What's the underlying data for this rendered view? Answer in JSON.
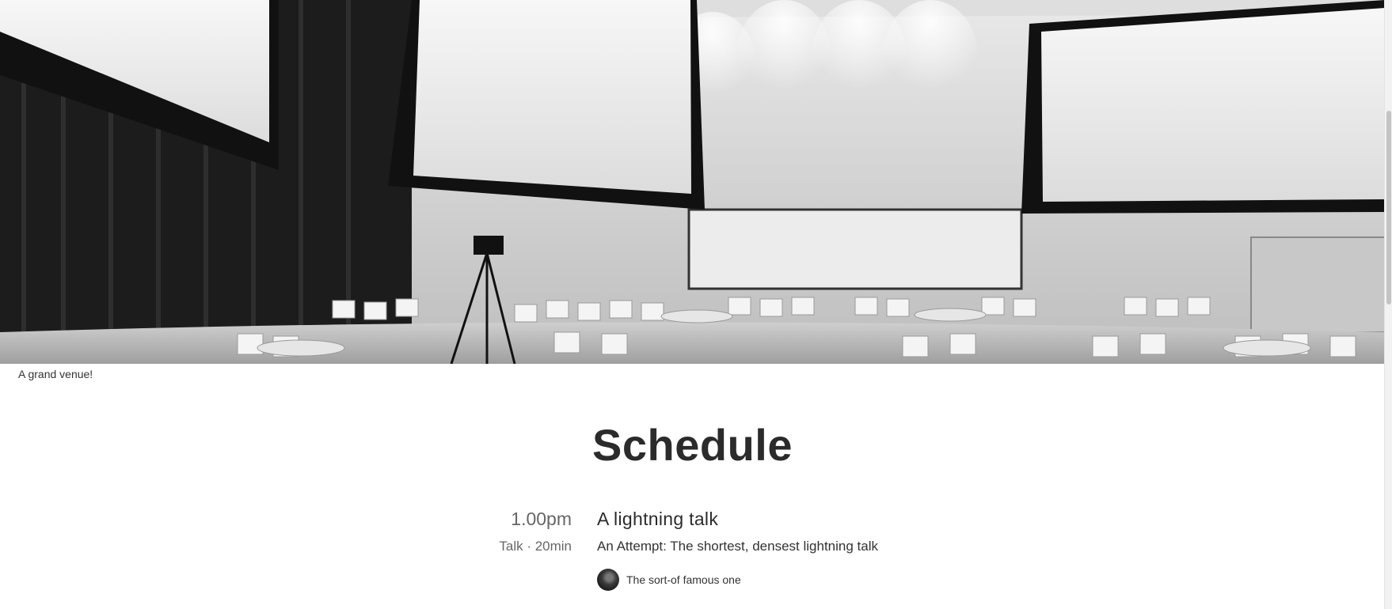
{
  "hero": {
    "image_name": "venue-photo",
    "caption": "A grand venue!"
  },
  "schedule": {
    "heading": "Schedule",
    "items": [
      {
        "time": "1.00pm",
        "meta": "Talk · 20min",
        "title": "A lightning talk",
        "description": "An Attempt: The shortest, densest lightning talk",
        "speaker": "The sort-of famous one",
        "speaker_icon": "avatar"
      }
    ]
  },
  "colors": {
    "background": "#ffffff",
    "heading": "#2b2b2b",
    "muted": "#666666"
  }
}
